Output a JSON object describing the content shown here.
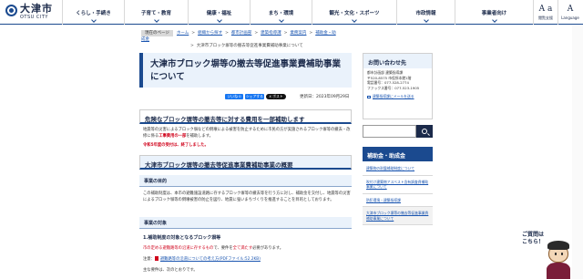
{
  "header": {
    "logo_jp": "大津市",
    "logo_en": "OTSU CITY",
    "nav": [
      {
        "label": "くらし・手続き"
      },
      {
        "label": "子育て・教育"
      },
      {
        "label": "健康・福祉"
      },
      {
        "label": "まち・環境"
      },
      {
        "label": "観光・文化・スポーツ"
      },
      {
        "label": "市政情報"
      },
      {
        "label": "事業者向け"
      }
    ],
    "util": [
      {
        "icon_text": "A a",
        "label": "閲覧支援"
      },
      {
        "icon_text": "A",
        "label": "Language"
      }
    ]
  },
  "breadcrumb": {
    "here_label": "現在のページ",
    "items": [
      "ホーム",
      "組織から探す",
      "都市計画部",
      "建築指導課",
      "業務案内",
      "補助金・助成金"
    ],
    "current": "大津市ブロック塀等の撤去等促進事業費補助事業について"
  },
  "page": {
    "title": "大津市ブロック塀等の撤去等促進事業費補助事業について",
    "social": {
      "like": "いいね 0",
      "share": "シェアする",
      "x": "X ポスト"
    },
    "updated": "更新日：2023年09月29日"
  },
  "sections": {
    "lead_head": "危険なブロック塀等の撤去等に対する費用を一部補助します",
    "lead_text_1": "地震等の災害によるブロック塀などの倒壊による被害を防止するために市民の方が実施されるブロック塀等の撤去・改修に係る",
    "lead_text_red": "工事費用の一部",
    "lead_text_2": "を補助します。",
    "notice": "令和5年度の受付は、終了しました。",
    "outline_head": "大津市ブロック塀等の撤去等促進事業費補助事業の概要",
    "purpose_head": "事業の目的",
    "purpose_text": "この補助制度は、本市の避難施設道路に存するブロック塀等の撤去等を行う方に対し、補助金を交付し、地震等の災害によるブロック塀等の倒壊被害の防止を図り、地震に強いまちづくりを推進することを目的としております。",
    "target_head": "事業の対象",
    "target_sub": "1.補助制度の対象となるブロック塀等",
    "target_red_1": "市の定める避難路等の沿道に存するもの",
    "target_text_1": "で、要件を",
    "target_red_2": "全て満たす",
    "target_text_2": "必要があります。",
    "note_label": "注意：",
    "note_link": "避難路等の沿道についての考え方(PDFファイル:52.2KB)",
    "main_label": "主な要件は、次のとおりです。"
  },
  "sidebar": {
    "contact_head": "お問い合わせ先",
    "dept": "都市計画部 建築指導課",
    "address": "〒520-8575 市役所本館1階",
    "tel": "電話番号：077-528-2774",
    "fax": "ファックス番号：077-523-1905",
    "mail_link": "建築指導課にメールを送る",
    "category_head": "補助金・助成金",
    "links": [
      "建築物の耐震補助制度について",
      "吹付け建築物アスベスト含有調査費補助事業について",
      "防犯環境・建築指導課",
      "大津市ブロック塀等の撤去等促進事業費補助事業について"
    ]
  },
  "question": {
    "line1": "ご質問は",
    "line2": "こちら！"
  }
}
